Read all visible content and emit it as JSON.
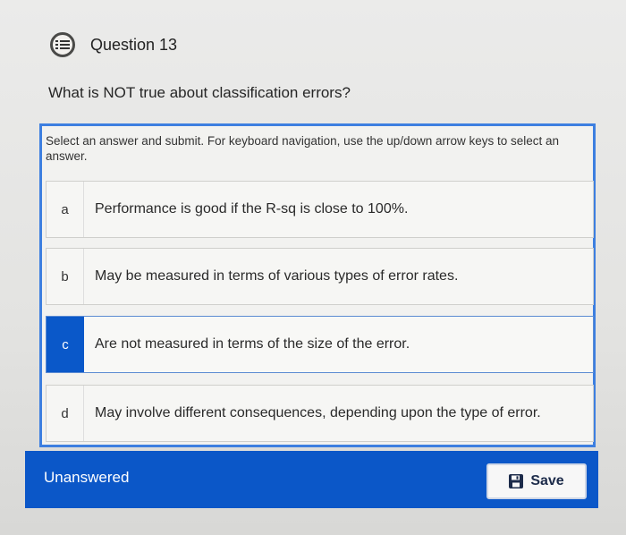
{
  "question": {
    "title": "Question 13",
    "icon": "question-list-icon",
    "prompt": "What is NOT true about classification errors?"
  },
  "answer_box": {
    "instructions": "Select an answer and submit. For keyboard navigation, use the up/down arrow keys to select an answer.",
    "options": [
      {
        "letter": "a",
        "text": "Performance is good if the R-sq is close to 100%."
      },
      {
        "letter": "b",
        "text": "May be measured in terms of various types of error rates."
      },
      {
        "letter": "c",
        "text": "Are not measured in terms of the size of the error.",
        "selected": true
      },
      {
        "letter": "d",
        "text": "May involve different consequences, depending upon the type of error."
      }
    ]
  },
  "footer": {
    "status": "Unanswered",
    "save_label": "Save",
    "save_icon": "save-icon"
  },
  "colors": {
    "accent": "#0b57c8",
    "card_border": "#3d7fe0",
    "selected_letter_bg": "#0a58c9"
  }
}
